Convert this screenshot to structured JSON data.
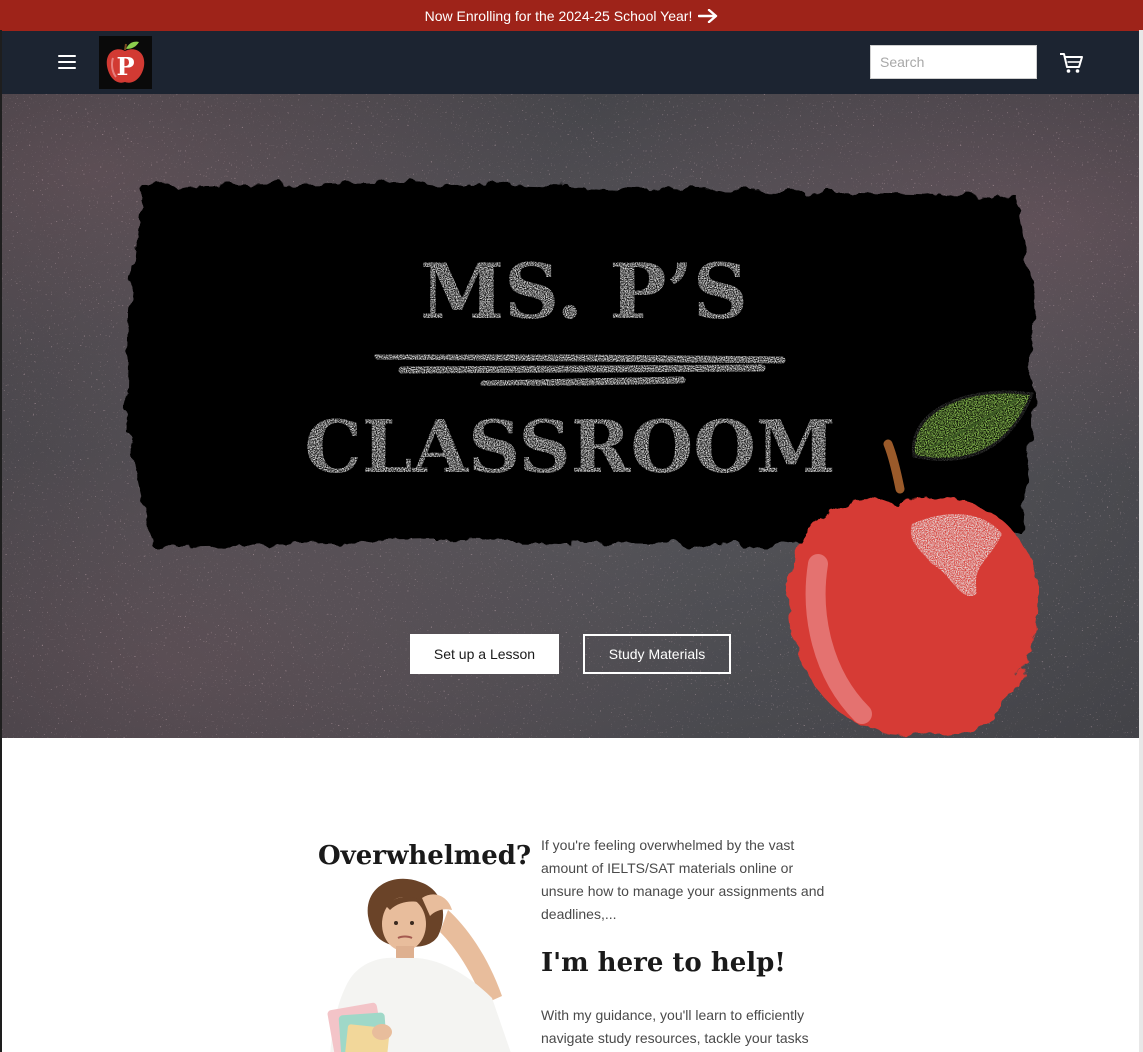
{
  "announcement": {
    "text": "Now Enrolling for the 2024-25 School Year!"
  },
  "header": {
    "logo_letter": "P",
    "search": {
      "placeholder": "Search",
      "value": ""
    }
  },
  "hero": {
    "title_line1": "MS. P’S",
    "title_line2": "CLASSROOM",
    "buttons": {
      "primary": "Set up a Lesson",
      "secondary": "Study Materials"
    }
  },
  "intro": {
    "heading1": "Overwhelmed?",
    "paragraph1": "If you're feeling overwhelmed by the vast amount of IELTS/SAT materials online or unsure how to manage your assignments and deadlines,...",
    "heading2": "I'm here to help!",
    "paragraph2": "With my guidance, you'll learn to efficiently navigate study resources, tackle your tasks"
  },
  "colors": {
    "announcement_bg": "#9e2319",
    "header_bg": "#1c2431",
    "chalkboard": "#4a4a4f",
    "apple_red": "#d63b35",
    "leaf_green": "#9bd65a"
  },
  "icons": [
    "menu-icon",
    "arrow-right-icon",
    "cart-icon",
    "apple-logo-icon"
  ]
}
